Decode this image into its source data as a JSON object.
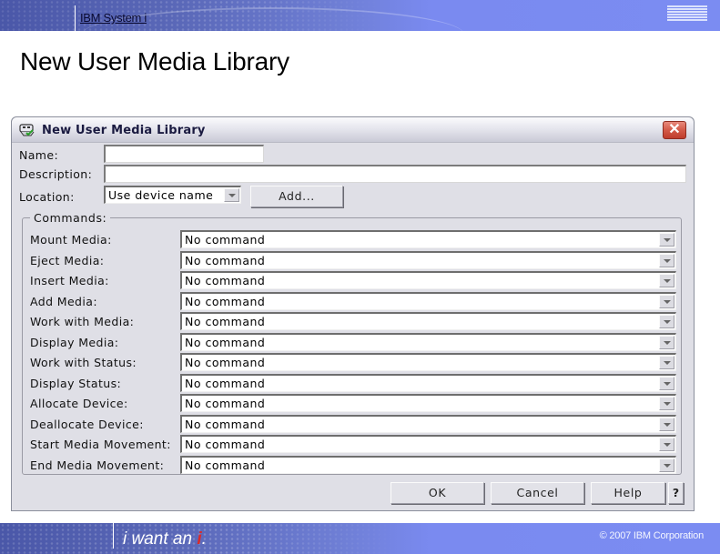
{
  "header": {
    "system_title": "IBM System i",
    "logo": "IBM"
  },
  "page_title": "New User Media Library",
  "dialog": {
    "title": "New User Media Library",
    "icon": "media-library-icon",
    "close_label": "✕",
    "fields": {
      "name_label": "Name:",
      "name_value": "",
      "description_label": "Description:",
      "description_value": "",
      "location_label": "Location:",
      "location_value": "Use device name",
      "add_button": "Add..."
    },
    "commands_legend": "Commands:",
    "commands": [
      {
        "label": "Mount Media:",
        "value": "No command"
      },
      {
        "label": "Eject Media:",
        "value": "No command"
      },
      {
        "label": "Insert Media:",
        "value": "No command"
      },
      {
        "label": "Add Media:",
        "value": "No command"
      },
      {
        "label": "Work with Media:",
        "value": "No command"
      },
      {
        "label": "Display Media:",
        "value": "No command"
      },
      {
        "label": "Work with Status:",
        "value": "No command"
      },
      {
        "label": "Display Status:",
        "value": "No command"
      },
      {
        "label": "Allocate Device:",
        "value": "No command"
      },
      {
        "label": "Deallocate Device:",
        "value": "No command"
      },
      {
        "label": "Start Media Movement:",
        "value": "No command"
      },
      {
        "label": "End Media Movement:",
        "value": "No command"
      }
    ],
    "buttons": {
      "ok": "OK",
      "cancel": "Cancel",
      "help": "Help",
      "context_help": "?"
    }
  },
  "footer": {
    "tagline_prefix": "i want an ",
    "tagline_accent": "i",
    "tagline_suffix": ".",
    "copyright": "© 2007 IBM Corporation"
  }
}
